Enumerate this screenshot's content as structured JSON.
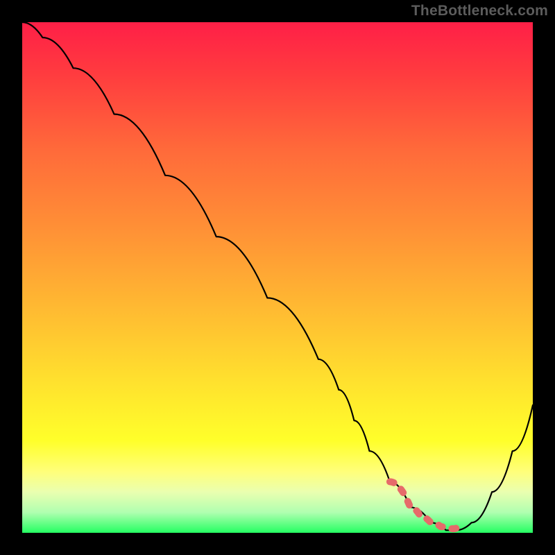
{
  "watermark": "TheBottleneck.com",
  "chart_data": {
    "type": "line",
    "title": "",
    "xlabel": "",
    "ylabel": "",
    "xlim": [
      0,
      100
    ],
    "ylim": [
      0,
      100
    ],
    "series": [
      {
        "name": "bottleneck-curve",
        "x": [
          0,
          4,
          10,
          18,
          28,
          38,
          48,
          58,
          62,
          65,
          68,
          72,
          76,
          80,
          83,
          85,
          88,
          92,
          96,
          100
        ],
        "y": [
          100,
          97,
          91,
          82,
          70,
          58,
          46,
          34,
          28,
          22,
          16,
          10,
          5,
          2,
          0.5,
          0.5,
          2,
          8,
          16,
          25
        ],
        "color": "#000000"
      }
    ],
    "highlight": {
      "name": "optimal-zone",
      "x": [
        72,
        76,
        78,
        80,
        82,
        83.5,
        84.5,
        86
      ],
      "y": [
        10,
        5,
        3.2,
        2,
        1.2,
        0.8,
        0.8,
        1.6
      ],
      "color": "#e66a6a"
    },
    "gradient_stops": [
      {
        "pos": 0,
        "color": "#ff1f47"
      },
      {
        "pos": 25,
        "color": "#ff6a3a"
      },
      {
        "pos": 55,
        "color": "#ffb732"
      },
      {
        "pos": 82,
        "color": "#ffff2a"
      },
      {
        "pos": 100,
        "color": "#25ff62"
      }
    ]
  }
}
